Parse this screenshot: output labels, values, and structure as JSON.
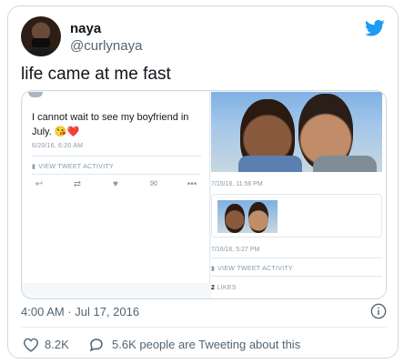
{
  "tweet": {
    "display_name": "naya",
    "handle": "@curlynaya",
    "text": "life came at me fast",
    "timestamp": "4:00 AM · Jul 17, 2016",
    "like_count": "8.2K",
    "conversation_text": "5.6K people are Tweeting about this"
  },
  "embed_left": {
    "text": "I cannot wait to see my boyfriend in July. 😘❤️",
    "time": "6/20/16, 6:20 AM",
    "activity": "VIEW TWEET ACTIVITY"
  },
  "embed_right": {
    "time1": "7/15/16, 11:56 PM",
    "time2": "7/16/16, 5:27 PM",
    "activity": "VIEW TWEET ACTIVITY",
    "likes_number": "2",
    "likes_label": "LIKES"
  },
  "colors": {
    "twitter_blue": "#1d9bf0",
    "secondary_text": "#536471",
    "border": "#cfd9de"
  }
}
